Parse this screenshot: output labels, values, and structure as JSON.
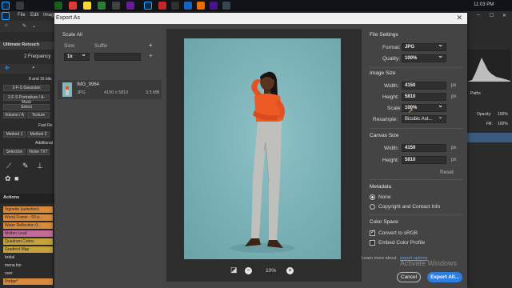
{
  "taskbar": {
    "clock": "11:03 PM",
    "app_title": "Adobe Photoshop"
  },
  "menubar": {
    "items": [
      "File",
      "Edit",
      "Imag"
    ]
  },
  "left_panel": {
    "title": "Ultimate Retouch",
    "freq_label": "2 Frequency",
    "buttons": [
      "2-F-S Gaussian",
      "2-F-S Portraiture / A-Mask",
      "Select",
      "Volume / A",
      "Texture",
      "Fast Re",
      "Method 1",
      "Method 2",
      "Additional",
      "Selection",
      "Noise TXT"
    ],
    "actions_title": "Actions",
    "actions": [
      {
        "label": "Vignette (selection)",
        "color": "#d98a3a"
      },
      {
        "label": "Wood Frame - 50 p...",
        "color": "#d98a3a"
      },
      {
        "label": "Water Reflection (t...",
        "color": "#d98a3a"
      },
      {
        "label": "Molten Lead",
        "color": "#c66a9a"
      },
      {
        "label": "Quadrant Colors",
        "color": "#c7a23c"
      },
      {
        "label": "Gradient Map",
        "color": "#c7a23c"
      },
      {
        "label": "bridal",
        "color": "#2b2b2b"
      },
      {
        "label": "mena bio",
        "color": "#2b2b2b"
      },
      {
        "label": "over",
        "color": "#2b2b2b"
      },
      {
        "label": "Dodge*",
        "color": "#d98a3a"
      }
    ]
  },
  "right_panel": {
    "paths": "Paths",
    "opacity": "Opacity:",
    "fill": "Fill:",
    "val1": "100%",
    "val2": "100%"
  },
  "dialog": {
    "title": "Export As",
    "scale_all": {
      "heading": "Scale All",
      "size_label": "Size:",
      "suffix_label": "Suffix",
      "size_value": "1x"
    },
    "file": {
      "name": "IMG_9964",
      "format": "JPG",
      "dimensions": "4150 x 5810",
      "filesize": "3.5 MB"
    },
    "zoom": "10%",
    "file_settings": {
      "heading": "File Settings",
      "format_label": "Format:",
      "format_value": "JPG",
      "quality_label": "Quality:",
      "quality_value": "100%"
    },
    "image_size": {
      "heading": "Image Size",
      "width_label": "Width:",
      "width_value": "4150",
      "height_label": "Height:",
      "height_value": "5810",
      "scale_label": "Scale:",
      "scale_value": "100%",
      "resample_label": "Resample:",
      "resample_value": "Bicubic Aut...",
      "unit": "px"
    },
    "canvas_size": {
      "heading": "Canvas Size",
      "width_label": "Width:",
      "width_value": "4150",
      "height_label": "Height:",
      "height_value": "5810",
      "reset": "Reset",
      "unit": "px"
    },
    "metadata": {
      "heading": "Metadata",
      "none": "None",
      "copyright": "Copyright and Contact Info"
    },
    "color_space": {
      "heading": "Color Space",
      "convert": "Convert to sRGB",
      "embed": "Embed Color Profile"
    },
    "learn_more": "Learn more about",
    "learn_link": "export options",
    "cancel": "Cancel",
    "export_all": "Export All..."
  },
  "watermark": "Activate Windows"
}
